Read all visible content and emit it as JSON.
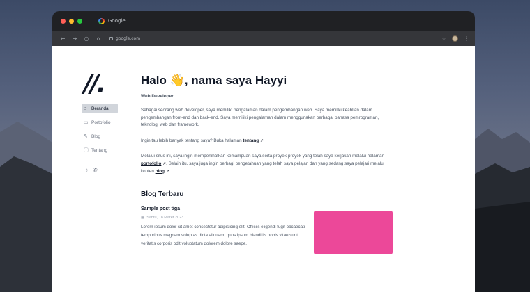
{
  "browser": {
    "tab_title": "Google",
    "url": "google.com"
  },
  "sidebar": {
    "items": [
      {
        "label": "Beranda",
        "icon": "home-icon"
      },
      {
        "label": "Portofolio",
        "icon": "briefcase-icon"
      },
      {
        "label": "Blog",
        "icon": "pencil-icon"
      },
      {
        "label": "Tentang",
        "icon": "info-icon"
      }
    ],
    "socials": [
      "github-icon",
      "whatsapp-icon"
    ]
  },
  "hero": {
    "title_before": "Halo",
    "emoji": "👋",
    "title_after": ", nama saya Hayyi",
    "role": "Web Developer",
    "p1": "Sebagai seorang web developer, saya memiliki pengalaman dalam pengembangan web. Saya memiliki keahlian dalam pengembangan front-end dan back-end. Saya memiliki pengalaman dalam menggunakan berbagai bahasa pemrograman, teknologi web dan framework.",
    "p2_before": "Ingin tau lebih banyak tentang saya? Buka halaman ",
    "p2_link": "tentang",
    "p3_before": "Melalui situs ini, saya ingin memperlihatkan kemampuan saya serta proyek-proyek yang telah saya kerjakan melalui halaman ",
    "p3_link1": "portofolio",
    "p3_mid": ". Selain itu, saya juga ingin berbagi pengetahuan yang telah saya pelajari dan yang sedang saya pelajari melalui konten ",
    "p3_link2": "blog",
    "p3_end": "."
  },
  "blog": {
    "heading": "Blog Terbaru",
    "post": {
      "title": "Sample post tiga",
      "date": "Sabtu, 18 Maret 2023",
      "excerpt": "Lorem ipsum dolor sit amet consectetur adipisicing elit. Officiis eligendi fugit obcaecati temporibus magnam voluptas dicta aliquam, quos ipsum blanditiis nobis vitae sunt veritatis corporis odit voluptatum dolorem dolore saepe."
    }
  },
  "colors": {
    "thumbnail": "#ec4899",
    "active_nav_bg": "#d1d5db"
  }
}
